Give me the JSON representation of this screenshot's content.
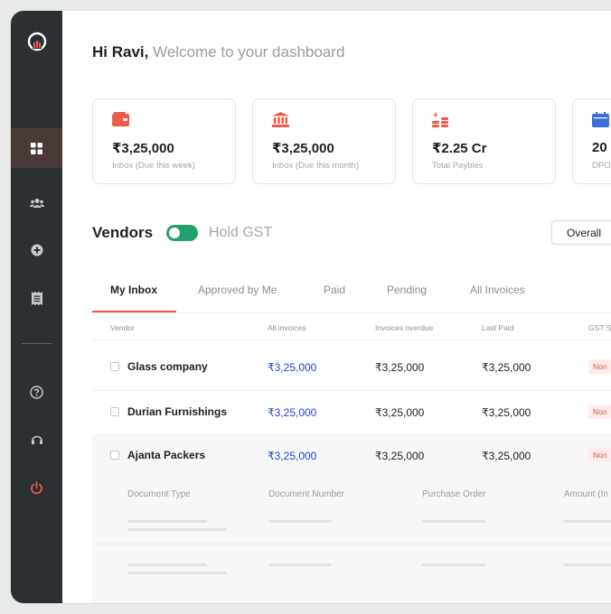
{
  "greeting": {
    "name": "Hi Ravi,",
    "sub": "Welcome to your dashboard"
  },
  "cards": [
    {
      "amount": "₹3,25,000",
      "label": "Inbox (Due this week)",
      "icon": "wallet-icon"
    },
    {
      "amount": "₹3,25,000",
      "label": "Inbox (Due this month)",
      "icon": "bank-icon"
    },
    {
      "amount": "₹2.25 Cr",
      "label": "Total Paybles",
      "icon": "coins-icon"
    },
    {
      "amount": "20",
      "label": "DPO",
      "icon": "calendar-icon"
    }
  ],
  "vendors": {
    "title": "Vendors",
    "toggle_label": "Hold GST",
    "toggle_on": true,
    "filter_label": "Overall"
  },
  "tabs": [
    "My Inbox",
    "Approved by Me",
    "Paid",
    "Pending",
    "All Invoices"
  ],
  "table": {
    "headers": [
      "Vendor",
      "All invoices",
      "Invoices overdue",
      "Last Paid",
      "GST S"
    ],
    "rows": [
      {
        "vendor": "Glass company",
        "all": "₹3,25,000",
        "overdue": "₹3,25,000",
        "last_paid": "₹3,25,000",
        "gst": "Non"
      },
      {
        "vendor": "Durian Furnishings",
        "all": "₹3,25,000",
        "overdue": "₹3,25,000",
        "last_paid": "₹3,25,000",
        "gst": "Non"
      },
      {
        "vendor": "Ajanta Packers",
        "all": "₹3,25,000",
        "overdue": "₹3,25,000",
        "last_paid": "₹3,25,000",
        "gst": "Non"
      }
    ],
    "expanded_headers": [
      "Document Type",
      "Document Number",
      "Purchase Order",
      "Amount (In"
    ]
  },
  "colors": {
    "sidebar": "#2b3132",
    "accent": "#ef5b4b",
    "toggle": "#24a06b",
    "link": "#2443d6",
    "calendar": "#3b6fe0"
  }
}
